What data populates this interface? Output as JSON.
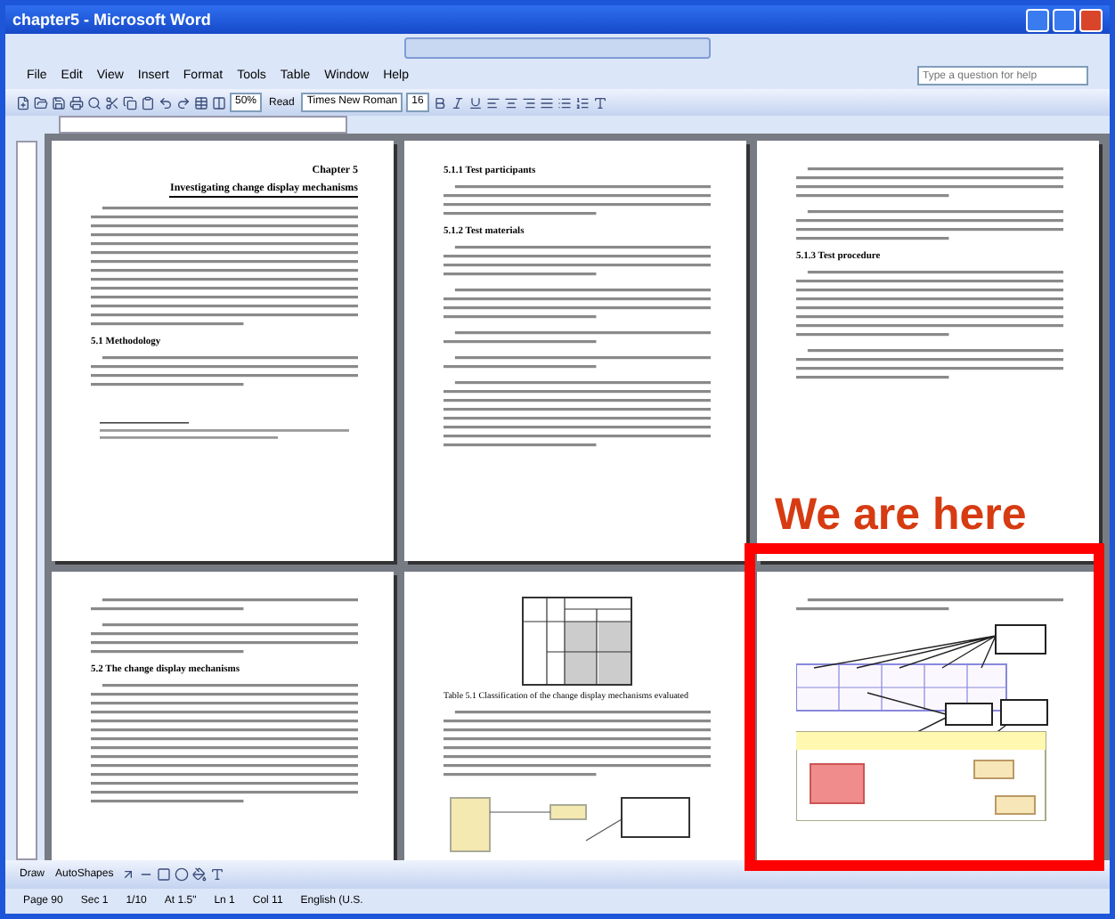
{
  "window": {
    "title": "chapter5 - Microsoft Word"
  },
  "menu": [
    "File",
    "Edit",
    "View",
    "Insert",
    "Format",
    "Tools",
    "Table",
    "Window",
    "Help"
  ],
  "help_box": {
    "placeholder": "Type a question for help"
  },
  "toolbar": {
    "zoom": "50%",
    "read_button": "Read",
    "font": "Times New Roman",
    "font_size": "16"
  },
  "pages": [
    {
      "blocks": [
        {
          "kind": "chapter-title",
          "label": "Chapter 5",
          "text": "Investigating change display mechanisms"
        },
        {
          "kind": "long-paragraph"
        },
        {
          "kind": "heading",
          "text": "5.1 Methodology"
        },
        {
          "kind": "short-paragraph"
        },
        {
          "kind": "footnote"
        }
      ]
    },
    {
      "blocks": [
        {
          "kind": "heading",
          "text": "5.1.1 Test participants"
        },
        {
          "kind": "short-paragraph"
        },
        {
          "kind": "heading",
          "text": "5.1.2 Test materials"
        },
        {
          "kind": "short-paragraph"
        },
        {
          "kind": "short-paragraph"
        },
        {
          "kind": "tiny-paragraph"
        },
        {
          "kind": "tiny-paragraph"
        },
        {
          "kind": "medium-paragraph"
        }
      ]
    },
    {
      "blocks": [
        {
          "kind": "short-paragraph"
        },
        {
          "kind": "short-paragraph"
        },
        {
          "kind": "heading",
          "text": "5.1.3 Test procedure"
        },
        {
          "kind": "medium-paragraph"
        },
        {
          "kind": "short-paragraph"
        }
      ]
    },
    {
      "blocks": [
        {
          "kind": "tiny-paragraph"
        },
        {
          "kind": "short-paragraph"
        },
        {
          "kind": "heading",
          "text": "5.2 The change display mechanisms"
        },
        {
          "kind": "long-paragraph"
        }
      ]
    },
    {
      "blocks": [
        {
          "kind": "table-figure"
        },
        {
          "kind": "caption",
          "text": "Table 5.1 Classification of the change display mechanisms evaluated"
        },
        {
          "kind": "medium-paragraph"
        },
        {
          "kind": "small-figure"
        }
      ]
    },
    {
      "blocks": [
        {
          "kind": "tiny-paragraph"
        },
        {
          "kind": "diagram-figure"
        }
      ]
    }
  ],
  "annotation": {
    "text": "We are here"
  },
  "drawing_toolbar": {
    "draw": "Draw",
    "autoshapes": "AutoShapes"
  },
  "status_bar": [
    "Page 90",
    "Sec 1",
    "1/10",
    "At 1.5\"",
    "Ln 1",
    "Col 11",
    "English (U.S."
  ]
}
